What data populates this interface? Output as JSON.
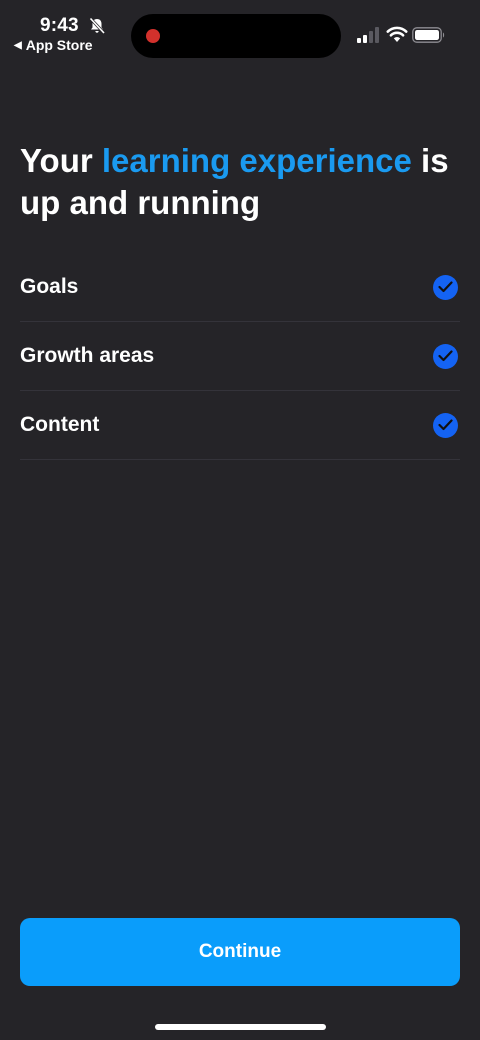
{
  "status_bar": {
    "time": "9:43",
    "back_app": "App Store",
    "icons": [
      "bell-slash-icon",
      "signal-icon",
      "wifi-icon",
      "battery-icon"
    ],
    "recording_indicator_color": "#d2312c"
  },
  "headline": {
    "part1": "Your ",
    "accent": "learning experience",
    "part2": " is up and running",
    "accent_color": "#1a9af0"
  },
  "checklist": {
    "items": [
      {
        "label": "Goals",
        "checked": true
      },
      {
        "label": "Growth areas",
        "checked": true
      },
      {
        "label": "Content",
        "checked": true
      }
    ],
    "check_color": "#1463f3"
  },
  "continue_button": {
    "label": "Continue",
    "color": "#0a9dfb"
  },
  "background_color": "#252428"
}
